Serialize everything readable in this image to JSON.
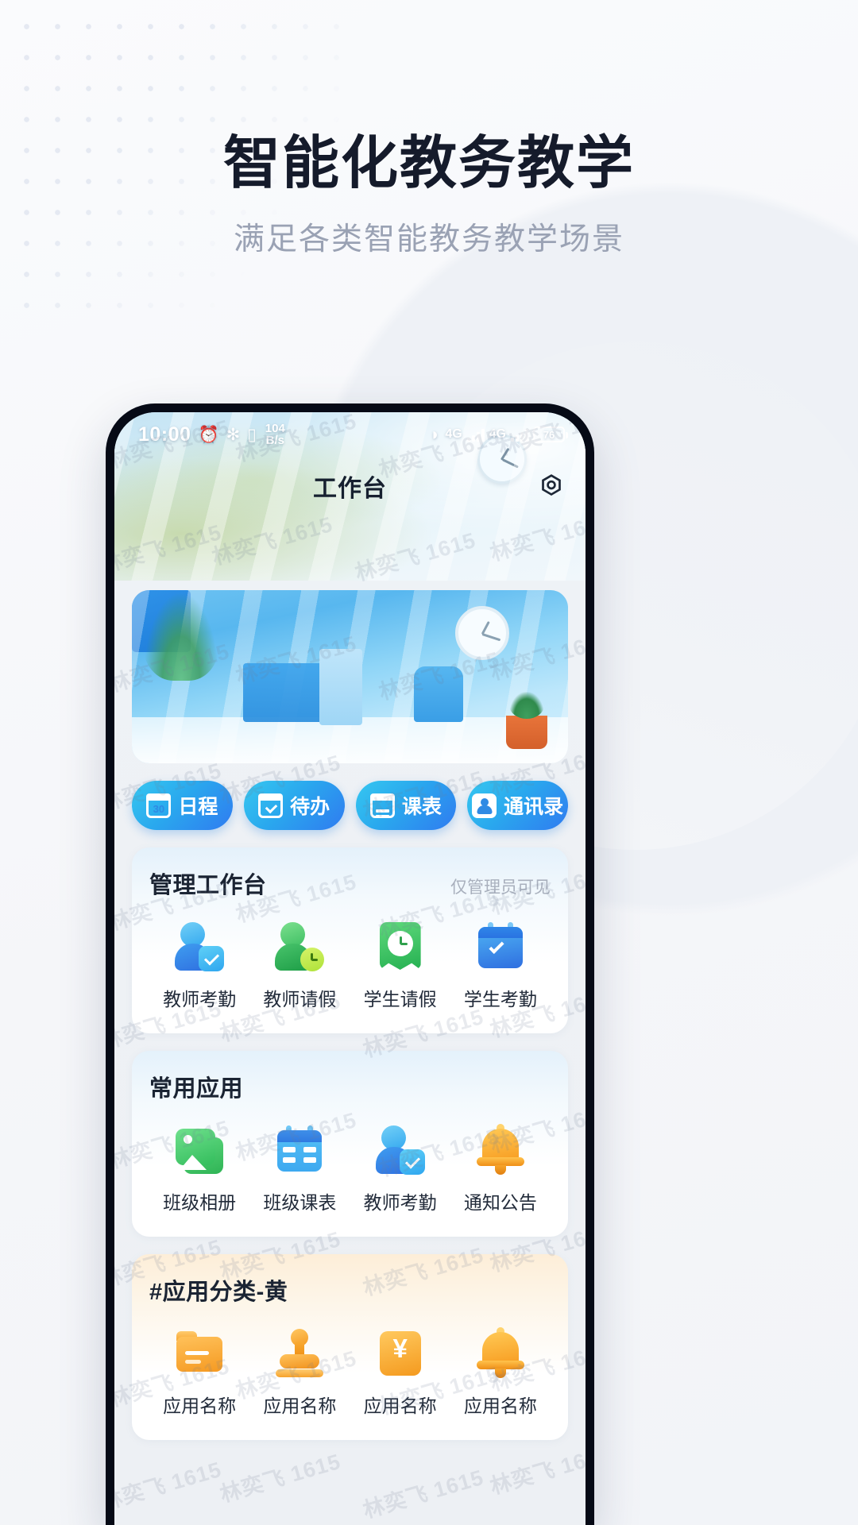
{
  "hero": {
    "title": "智能化教务教学",
    "subtitle": "满足各类智能教务教学场景"
  },
  "watermark": {
    "text": "林奕飞 1615"
  },
  "phone": {
    "statusbar": {
      "time": "10:00",
      "alarm_icon": "alarm-icon",
      "bluetooth_icon": "bluetooth-icon",
      "vibrate_icon": "vibrate-icon",
      "net_speed_value": "104",
      "net_speed_unit": "B/s",
      "wifi_icon": "wifi-icon",
      "network_type_1": "4G",
      "network_type_2": "4G",
      "battery_level": "76"
    },
    "appbar": {
      "title": "工作台",
      "settings_icon": "gear-icon"
    },
    "banner": {
      "alt": "office-illustration-banner"
    },
    "quick_actions": [
      {
        "label": "日程",
        "icon": "calendar-30-icon",
        "icon_text": "30"
      },
      {
        "label": "待办",
        "icon": "calendar-check-icon"
      },
      {
        "label": "课表",
        "icon": "schedule-icon"
      },
      {
        "label": "通讯录",
        "icon": "contacts-icon"
      }
    ],
    "sections": [
      {
        "title": "管理工作台",
        "note": "仅管理员可见",
        "style": "cool",
        "items": [
          {
            "label": "教师考勤",
            "icon": "user-check-icon"
          },
          {
            "label": "教师请假",
            "icon": "user-clock-icon"
          },
          {
            "label": "学生请假",
            "icon": "tag-clock-icon"
          },
          {
            "label": "学生考勤",
            "icon": "calendar-check-icon"
          }
        ]
      },
      {
        "title": "常用应用",
        "note": "",
        "style": "cool",
        "items": [
          {
            "label": "班级相册",
            "icon": "photo-icon"
          },
          {
            "label": "班级课表",
            "icon": "calendar-grid-icon"
          },
          {
            "label": "教师考勤",
            "icon": "user-check-icon"
          },
          {
            "label": "通知公告",
            "icon": "bell-icon"
          }
        ]
      },
      {
        "title": "#应用分类-黄",
        "note": "",
        "style": "warm",
        "items": [
          {
            "label": "应用名称",
            "icon": "folder-icon"
          },
          {
            "label": "应用名称",
            "icon": "stamp-icon"
          },
          {
            "label": "应用名称",
            "icon": "yuan-icon"
          },
          {
            "label": "应用名称",
            "icon": "bell-icon"
          }
        ]
      }
    ]
  },
  "colors": {
    "accent_blue": "#2f8ae4",
    "accent_green": "#2fb455",
    "accent_orange": "#f59a22",
    "title_dark": "#151b2b",
    "subtitle_gray": "#9aa2b4"
  }
}
